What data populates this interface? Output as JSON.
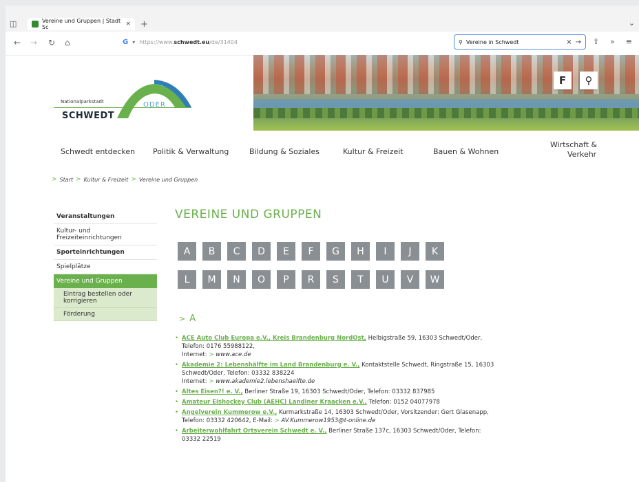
{
  "browser": {
    "tab_title": "Vereine und Gruppen | Stadt Sc",
    "tab_close": "×",
    "new_tab": "+",
    "url_prefix": "https://www.",
    "url_domain": "schwedt.eu",
    "url_path": "/de/31404",
    "search_value": "Vereine in Schwedt",
    "search_clear": "×",
    "search_go": "→"
  },
  "site": {
    "logo_top": "Nationalparkstadt",
    "logo_main": "SCHWEDT",
    "logo_oder": "ODER",
    "nav": [
      "Schwedt entdecken",
      "Politik & Verwaltung",
      "Bildung & Soziales",
      "Kultur & Freizeit",
      "Bauen & Wohnen",
      "Wirtschaft &",
      "Verkehr"
    ],
    "breadcrumbs": [
      "Start",
      "Kultur & Freizeit",
      "Vereine und Gruppen"
    ],
    "sidebar": {
      "items": [
        "Veranstaltungen",
        "Kultur- und",
        "Freizeiteinrichtungen",
        "Sporteinrichtungen",
        "Spielplätze",
        "Vereine und Gruppen"
      ],
      "subitems": [
        "Eintrag bestellen oder",
        "korrigieren",
        "Förderung"
      ]
    },
    "page_title": "VEREINE UND GRUPPEN",
    "letters_row1": [
      "A",
      "B",
      "C",
      "D",
      "E",
      "F",
      "G",
      "H",
      "I",
      "J",
      "K"
    ],
    "letters_row2": [
      "L",
      "M",
      "N",
      "O",
      "P",
      "R",
      "S",
      "T",
      "U",
      "V",
      "W"
    ],
    "section_letter": "A",
    "entries": [
      {
        "name": "ACE Auto Club Europa e.V., Kreis Brandenburg NordOst,",
        "text": " Helbigstraße 59, 16303 Schwedt/Oder,",
        "line2": "Telefon: 0176 55988122,",
        "line3_label": "Internet:",
        "line3_link": "www.ace.de"
      },
      {
        "name": "Akademie 2: Lebenshälfte im Land Brandenburg e. V.,",
        "text": " Kontaktstelle Schwedt, Ringstraße 15, 16303",
        "line2": "Schwedt/Oder, Telefon: 03332 838224",
        "line3_label": "Internet:",
        "line3_link": "www.akademie2.lebenshaelfte.de"
      },
      {
        "name": "Altes Eisen?! e. V.,",
        "text": " Berliner Straße 19, 16303 Schwedt/Oder, Telefon: 03332 837985",
        "line2": "",
        "line3_label": "",
        "line3_link": ""
      },
      {
        "name": "Amateur Eishockey Club (AEHC) Landiner Kraacken e.V.,",
        "text": " Telefon: 0152 04077978",
        "line2": "",
        "line3_label": "",
        "line3_link": ""
      },
      {
        "name": "Angelverein Kummerow e.V.,",
        "text": " Kurmarkstraße 14, 16303 Schwedt/Oder, Vorsitzender: Gert Glasenapp,",
        "line2": "Telefon: 03332 420642, E-Mail:",
        "line3_label": "",
        "line3_link": "AV.Kummerow1953@t-online.de"
      },
      {
        "name": "Arbeiterwohlfahrt Ortsverein Schwedt e. V.,",
        "text": " Berliner Straße 137c, 16303 Schwedt/Oder, Telefon:",
        "line2": "03332 22519",
        "line3_label": "",
        "line3_link": ""
      }
    ]
  }
}
